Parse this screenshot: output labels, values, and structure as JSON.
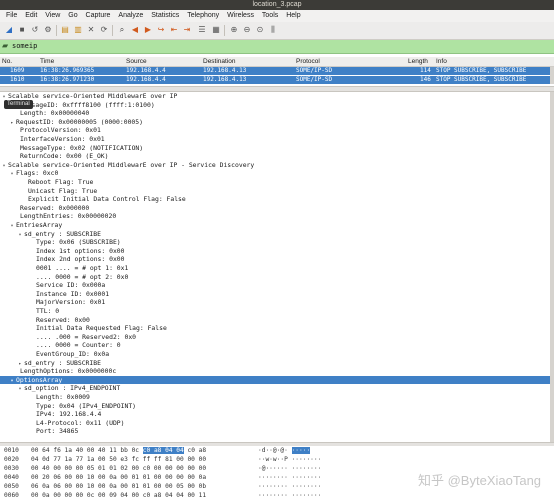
{
  "window": {
    "title": "location_3.pcap"
  },
  "menu": [
    "File",
    "Edit",
    "View",
    "Go",
    "Capture",
    "Analyze",
    "Statistics",
    "Telephony",
    "Wireless",
    "Tools",
    "Help"
  ],
  "filter": {
    "value": "someip"
  },
  "packet_list": {
    "columns": {
      "no": "No.",
      "time": "Time",
      "source": "Source",
      "destination": "Destination",
      "protocol": "Protocol",
      "length": "Length",
      "info": "Info"
    },
    "rows": [
      {
        "no": "1609",
        "time": "16:38:26.969365",
        "source": "192.168.4.4",
        "destination": "192.168.4.13",
        "protocol": "SOME/IP-SD",
        "length": "114",
        "info": "STOP SUBSCRIBE, SUBSCRIBE"
      },
      {
        "no": "1610",
        "time": "16:38:26.971230",
        "source": "192.168.4.4",
        "destination": "192.168.4.13",
        "protocol": "SOME/IP-SD",
        "length": "146",
        "info": "STOP SUBSCRIBE, SUBSCRIBE"
      }
    ]
  },
  "tooltip": "Terminal",
  "details": [
    {
      "tw": "▾",
      "indent": 0,
      "text": "Scalable service-Oriented MiddlewarE over IP"
    },
    {
      "tw": "",
      "indent": 3,
      "text": "MessageID: 0xffff8100 (ffff:1:0100)"
    },
    {
      "tw": "",
      "indent": 3,
      "text": "Length: 0x00000040"
    },
    {
      "tw": "▸",
      "indent": 2,
      "text": "RequestID: 0x00000005 (0000:0005)"
    },
    {
      "tw": "",
      "indent": 3,
      "text": "ProtocolVersion: 0x01"
    },
    {
      "tw": "",
      "indent": 3,
      "text": "InterfaceVersion: 0x01"
    },
    {
      "tw": "",
      "indent": 3,
      "text": "MessageType: 0x02 (NOTIFICATION)"
    },
    {
      "tw": "",
      "indent": 3,
      "text": "ReturnCode: 0x00 (E_OK)"
    },
    {
      "tw": "▾",
      "indent": 0,
      "text": "Scalable service-Oriented MiddlewarE over IP - Service Discovery"
    },
    {
      "tw": "▾",
      "indent": 2,
      "text": "Flags: 0xc0"
    },
    {
      "tw": "",
      "indent": 5,
      "text": "Reboot Flag: True"
    },
    {
      "tw": "",
      "indent": 5,
      "text": "Unicast Flag: True"
    },
    {
      "tw": "",
      "indent": 5,
      "text": "Explicit Initial Data Control Flag: False"
    },
    {
      "tw": "",
      "indent": 3,
      "text": "Reserved: 0x000000"
    },
    {
      "tw": "",
      "indent": 3,
      "text": "LengthEntries: 0x00000020"
    },
    {
      "tw": "▾",
      "indent": 2,
      "text": "EntriesArray"
    },
    {
      "tw": "▾",
      "indent": 4,
      "text": "sd_entry : SUBSCRIBE"
    },
    {
      "tw": "",
      "indent": 7,
      "text": "Type: 0x06 (SUBSCRIBE)"
    },
    {
      "tw": "",
      "indent": 7,
      "text": "Index 1st options: 0x00"
    },
    {
      "tw": "",
      "indent": 7,
      "text": "Index 2nd options: 0x00"
    },
    {
      "tw": "",
      "indent": 7,
      "text": "0001 .... = # opt 1: 0x1"
    },
    {
      "tw": "",
      "indent": 7,
      "text": ".... 0000 = # opt 2: 0x0"
    },
    {
      "tw": "",
      "indent": 7,
      "text": "Service ID: 0x000a"
    },
    {
      "tw": "",
      "indent": 7,
      "text": "Instance ID: 0x0001"
    },
    {
      "tw": "",
      "indent": 7,
      "text": "MajorVersion: 0x01"
    },
    {
      "tw": "",
      "indent": 7,
      "text": "TTL: 0"
    },
    {
      "tw": "",
      "indent": 7,
      "text": "Reserved: 0x00"
    },
    {
      "tw": "",
      "indent": 7,
      "text": "Initial Data Requested Flag: False"
    },
    {
      "tw": "",
      "indent": 7,
      "text": ".... .000 = Reserved2: 0x0"
    },
    {
      "tw": "",
      "indent": 7,
      "text": ".... 0000 = Counter: 0"
    },
    {
      "tw": "",
      "indent": 7,
      "text": "EventGroup_ID: 0x0a"
    },
    {
      "tw": "▸",
      "indent": 4,
      "text": "sd_entry : SUBSCRIBE"
    },
    {
      "tw": "",
      "indent": 3,
      "text": "LengthOptions: 0x0000000c"
    },
    {
      "tw": "▾",
      "indent": 2,
      "text": "OptionsArray",
      "selected": true
    },
    {
      "tw": "▾",
      "indent": 4,
      "text": "sd_option : IPv4_ENDPOINT"
    },
    {
      "tw": "",
      "indent": 7,
      "text": "Length: 0x0009"
    },
    {
      "tw": "",
      "indent": 7,
      "text": "Type: 0x04 (IPv4_ENDPOINT)"
    },
    {
      "tw": "",
      "indent": 7,
      "text": "IPv4: 192.168.4.4"
    },
    {
      "tw": "",
      "indent": 7,
      "text": "L4-Protocol: 0x11 (UDP)"
    },
    {
      "tw": "",
      "indent": 7,
      "text": "Port: 34865"
    }
  ],
  "hex": [
    {
      "offset": "0010",
      "pre": "00 64 f6 1a 40 00 40 11  bb 0c",
      "hl": "c0 a8 04 04",
      "post": "c0 a8",
      "ascii_pre": "·d··@·@·",
      "ascii_hl": "·····",
      "ascii_post": ""
    },
    {
      "offset": "0020",
      "pre": "04 0d 77 1a 77 1a 00 50  e3 fc ff ff 81 00 00 00",
      "hl": "",
      "post": "",
      "ascii_pre": "··w·w··P",
      "ascii_hl": "",
      "ascii_post": "········"
    },
    {
      "offset": "0030",
      "pre": "00 40 00 00 00 05 01 01  02 00 c0 00 00 00 00 00",
      "hl": "",
      "post": "",
      "ascii_pre": "·@······",
      "ascii_hl": "",
      "ascii_post": "········"
    },
    {
      "offset": "0040",
      "pre": "00 20 06 00 00 10 00 0a  00 01 01 00 00 00 00 0a",
      "hl": "",
      "post": "",
      "ascii_pre": "········",
      "ascii_hl": "",
      "ascii_post": "········"
    },
    {
      "offset": "0050",
      "pre": "06 0a 06 00 00 10 00 0a  00 01 01 00 00 05 00 0b",
      "hl": "",
      "post": "",
      "ascii_pre": "········",
      "ascii_hl": "",
      "ascii_post": "········"
    },
    {
      "offset": "0060",
      "pre": "00 0a 00 00 00 0c 00 09  04 00 c0 a8 04 04 00 11",
      "hl": "",
      "post": "",
      "ascii_pre": "········",
      "ascii_hl": "",
      "ascii_post": "········"
    }
  ],
  "watermark": "知乎 @ByteXiaoTang",
  "colors": {
    "selection": "#3f80c6",
    "filter_ok": "#afe3a2",
    "titlebar": "#3c3b37"
  }
}
